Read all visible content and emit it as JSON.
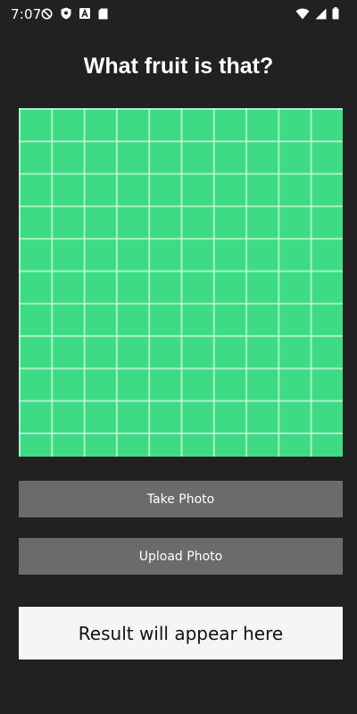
{
  "status_bar": {
    "time": "7:07",
    "left_icons": [
      "do-not-disturb-icon",
      "shield-icon",
      "font-icon",
      "sd-card-icon"
    ],
    "right_icons": [
      "wifi-icon",
      "signal-icon",
      "battery-icon"
    ]
  },
  "header": {
    "title": "What fruit is that?"
  },
  "preview": {
    "icon": "image-preview-grid",
    "background_color": "#3ddc84"
  },
  "actions": {
    "take_photo_label": "Take Photo",
    "upload_photo_label": "Upload Photo"
  },
  "result": {
    "text": "Result will appear here"
  },
  "colors": {
    "background": "#212121",
    "button": "#6b6b6b",
    "result_bg": "#f5f5f5",
    "accent_green": "#3ddc84"
  }
}
